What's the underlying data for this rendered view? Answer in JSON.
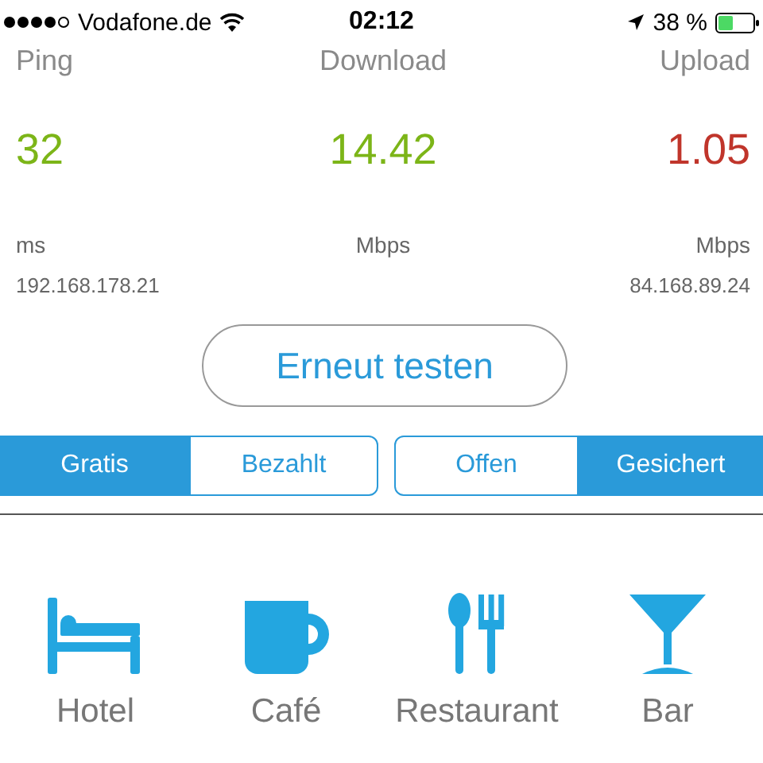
{
  "status_bar": {
    "carrier": "Vodafone.de",
    "time": "02:12",
    "battery": "38 %"
  },
  "stats": [
    {
      "label": "Ping",
      "value": "32",
      "color": "#7cb518",
      "unit": "ms",
      "address": "192.168.178.21"
    },
    {
      "label": "Download",
      "value": "14.42",
      "color": "#7cb518",
      "unit": "Mbps"
    },
    {
      "label": "Upload",
      "value": "1.05",
      "color": "#c0352b",
      "unit": "Mbps",
      "address": "84.168.89.24"
    }
  ],
  "retest_button": "Erneut testen",
  "segments": [
    {
      "options": [
        {
          "label": "Gratis",
          "selected": true
        },
        {
          "label": "Bezahlt",
          "selected": false
        }
      ]
    },
    {
      "options": [
        {
          "label": "Offen",
          "selected": false
        },
        {
          "label": "Gesichert",
          "selected": true
        }
      ]
    }
  ],
  "categories": [
    {
      "kind": "hotel",
      "label": "Hotel"
    },
    {
      "kind": "cafe",
      "label": "Café"
    },
    {
      "kind": "restaurant",
      "label": "Restaurant"
    },
    {
      "kind": "bar",
      "label": "Bar"
    }
  ]
}
